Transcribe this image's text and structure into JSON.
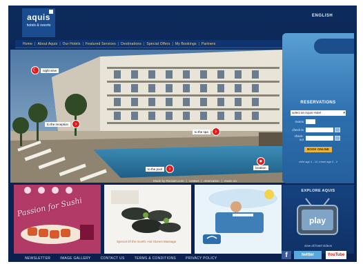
{
  "logo": {
    "brand": "aquis",
    "sub": "hotels & resorts"
  },
  "language": "ENGLISH",
  "nav": [
    "Home",
    "About Aquis",
    "Our Hotels",
    "Featured Services",
    "Destinations",
    "Special Offers",
    "My Bookings",
    "Partners"
  ],
  "hotspots": {
    "night_view": "night view",
    "reception": "to the reception",
    "spa": "to the spa",
    "pool": "to the pool",
    "location": "location"
  },
  "footer_links": [
    "Made by Reclaim.com",
    "|",
    "contact",
    "|",
    "reservation",
    "|",
    "music on"
  ],
  "reservations": {
    "title": "RESERVATIONS",
    "select_label": "select an Aquis Hotel",
    "rooms_label": "rooms",
    "checkin_label": "check-in",
    "checkout_label": "check-out",
    "book_label": "BOOK ONLINE",
    "notes": "child age 2 - 12, infant age 0 - 2"
  },
  "thumbs": {
    "sushi": "Passion for Sushi",
    "massage": "Special Of the month: Hot Stones Massage"
  },
  "explore": {
    "title": "EXPLORE AQUIS",
    "play": "play",
    "link": "view all hotel videos"
  },
  "bottom_nav": [
    "NEWSLETTER",
    "IMAGE GALLERY",
    "CONTACT US",
    "TERMS & CONDITIONS",
    "PRIVACY POLICY"
  ],
  "social": {
    "facebook": "f",
    "twitter": "twitter",
    "youtube": "YouTube"
  },
  "colors": {
    "navy": "#0d2a5c",
    "accent_red": "#e21a1a",
    "gold": "#f2d889",
    "panel_blue": "#2d6fae"
  }
}
